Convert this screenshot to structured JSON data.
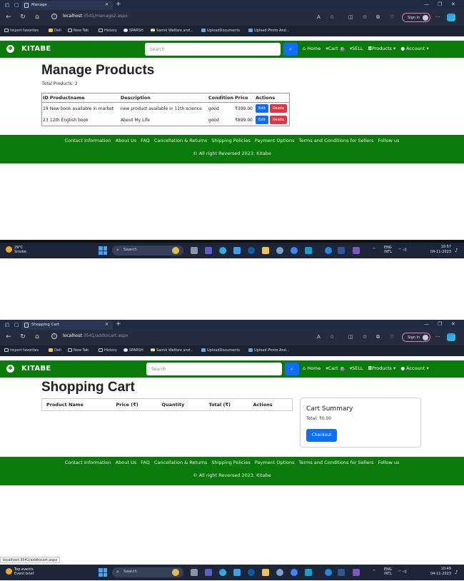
{
  "shot1": {
    "tab_title": "Manage",
    "url_host": "localhost",
    "url_rest": ":3541/manage2.aspx",
    "signin": "Sign in",
    "favorites": [
      "Import favorites",
      "Dell",
      "New Tab",
      "History",
      "SPARSH",
      "Samik Welfare and...",
      "UploadDocuments",
      "Upload Photo And..."
    ],
    "brand": "KITABE",
    "search_placeholder": "Search",
    "nav": {
      "home": "Home",
      "cart": "Cart",
      "cart_count": "0",
      "sell": "SELL",
      "products": "Products",
      "account": "Account"
    },
    "title": "Manage Products",
    "total": "Total Products: 2",
    "table": {
      "headers": [
        "ID",
        "Productname",
        "Description",
        "Condition",
        "Price",
        "Actions"
      ],
      "rows": [
        {
          "id": "19",
          "name": "New book available in market",
          "desc": "new product available in 11th science",
          "cond": "good",
          "price": "₹399.00"
        },
        {
          "id": "23",
          "name": "12th English book",
          "desc": "About My Life",
          "cond": "good",
          "price": "₹899.00"
        }
      ],
      "edit": "Edit",
      "delete": "Delete"
    },
    "footer_links": [
      "Contact Information",
      "About Us",
      "FAQ",
      "Cancellation & Returns",
      "Shipping Policies",
      "Payment Options",
      "Terms and Conditions for Sellers",
      "Follow us"
    ],
    "copyright": "© All right Reversed 2023. Kitabe",
    "weather_temp": "29°C",
    "weather_desc": "Smoke",
    "search_taskbar": "Search",
    "lang1": "ENG",
    "lang2": "INTL",
    "time": "10:57",
    "date": "04-11-2023"
  },
  "shot2": {
    "tab_title": "Shopping Cart",
    "url_host": "localhost",
    "url_rest": ":3541/addtocart.aspx",
    "signin": "Sign in",
    "brand": "KITABE",
    "search_placeholder": "Search",
    "nav": {
      "home": "Home",
      "cart": "Cart",
      "cart_count": "0",
      "sell": "SELL",
      "products": "Products",
      "account": "Account"
    },
    "title": "Shopping Cart",
    "table_headers": [
      "Product Name",
      "Price (₹)",
      "Quantity",
      "Total (₹)",
      "Actions"
    ],
    "summary_title": "Cart Summary",
    "summary_total": "Total: ₹0.00",
    "checkout": "Checkout",
    "copyright": "© All right Reversed 2023. Kitabe",
    "status_url": "localhost:3541/addtocart.aspx",
    "weather_temp": "Top events",
    "weather_desc": "Event brief",
    "time": "10:49",
    "date": "04-11-2023"
  }
}
